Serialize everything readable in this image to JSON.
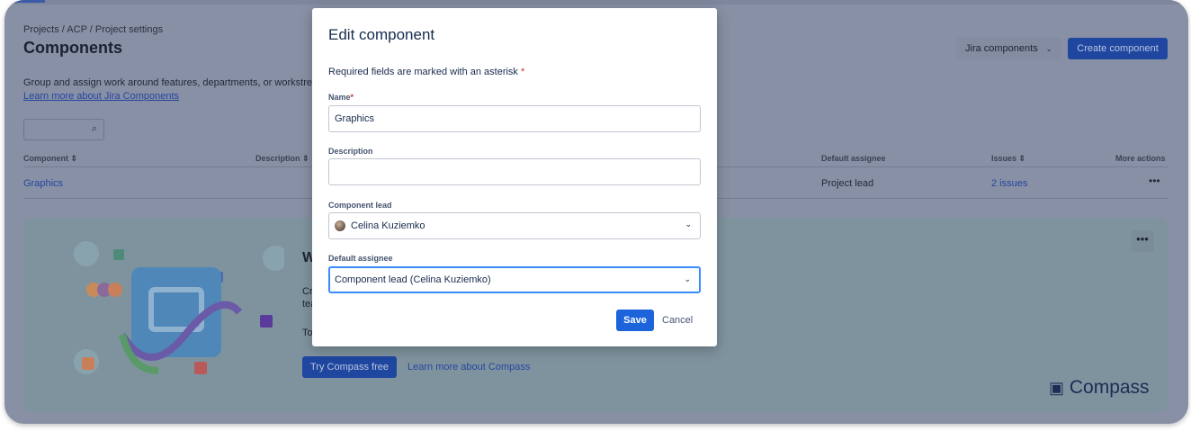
{
  "page": {
    "breadcrumb": "Projects  /  ACP  /  Project settings",
    "title": "Components",
    "description": "Group and assign work around features, departments, or workstrea",
    "learn_more": "Learn more about Jira Components",
    "jira_components": "Jira components",
    "create_component": "Create component"
  },
  "table": {
    "headers": [
      "Component ⇕",
      "Description ⇕",
      "Default assignee",
      "Issues ⇕",
      "More actions"
    ],
    "rows": [
      {
        "component": "Graphics",
        "default_assignee": "Project lead",
        "issues": "2 issues",
        "more": "•••"
      }
    ]
  },
  "banner": {
    "heading": "W",
    "line1": "Cr",
    "line2": "tea",
    "line3": "To",
    "try": "Try Compass free",
    "learn": "Learn more about Compass",
    "brand": "Compass",
    "more": "•••"
  },
  "modal": {
    "title": "Edit component",
    "required_note": "Required fields are marked with an asterisk",
    "asterisk": "*",
    "name_label": "Name",
    "name_value": "Graphics",
    "description_label": "Description",
    "description_value": "",
    "lead_label": "Component lead",
    "lead_value": "Celina Kuziemko",
    "assignee_label": "Default assignee",
    "assignee_value": "Component lead (Celina Kuziemko)",
    "save": "Save",
    "cancel": "Cancel"
  },
  "colors": {
    "primary": "#1d64db",
    "overlay": "#8890a5",
    "focus": "#388bff"
  }
}
